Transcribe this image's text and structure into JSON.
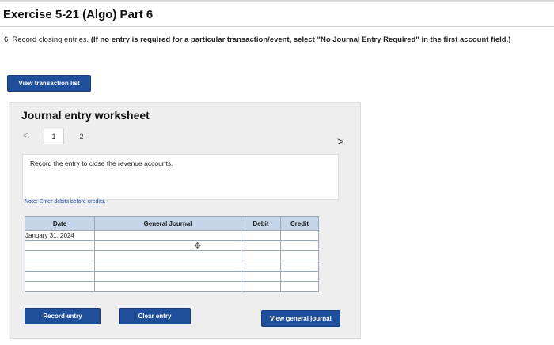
{
  "header": {
    "title": "Exercise 5-21 (Algo) Part 6"
  },
  "question": {
    "prefix": "6. Record closing entries. ",
    "bold": "(If no entry is required for a particular transaction/event, select \"No Journal Entry Required\" in the first account field.)"
  },
  "buttons": {
    "view_transaction_list": "View transaction list",
    "record_entry": "Record entry",
    "clear_entry": "Clear entry",
    "view_general_journal": "View general journal"
  },
  "worksheet": {
    "title": "Journal entry worksheet",
    "nav_prev": "<",
    "nav_next": ">",
    "pages": [
      "1",
      "2"
    ],
    "instruction": "Record the entry to close the revenue accounts.",
    "note": "Note: Enter debits before credits."
  },
  "journal": {
    "headers": {
      "date": "Date",
      "general_journal": "General Journal",
      "debit": "Debit",
      "credit": "Credit"
    },
    "rows": [
      {
        "date": "January 31, 2024"
      },
      {
        "date": ""
      },
      {
        "date": ""
      },
      {
        "date": ""
      },
      {
        "date": ""
      },
      {
        "date": ""
      }
    ]
  },
  "icons": {
    "cursor": "move-cursor-icon"
  },
  "colors": {
    "button_blue": "#1f4e9b",
    "table_header": "#c6d6ea"
  }
}
